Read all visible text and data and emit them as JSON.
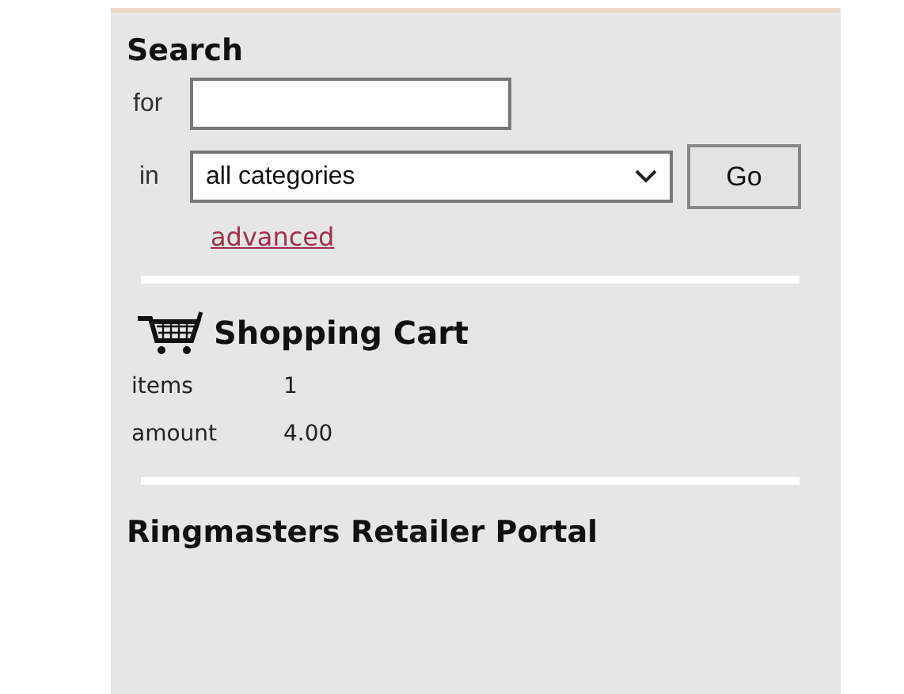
{
  "search": {
    "title": "Search",
    "for_label": "for",
    "in_label": "in",
    "category": "all categories",
    "button": "Go",
    "advanced_link": "advanced"
  },
  "cart": {
    "title": "Shopping Cart",
    "rows": [
      {
        "label": "items",
        "value": "1"
      },
      {
        "label": "amount",
        "value": "4.00"
      }
    ]
  },
  "portal": {
    "title": "Ringmasters Retailer Portal"
  }
}
